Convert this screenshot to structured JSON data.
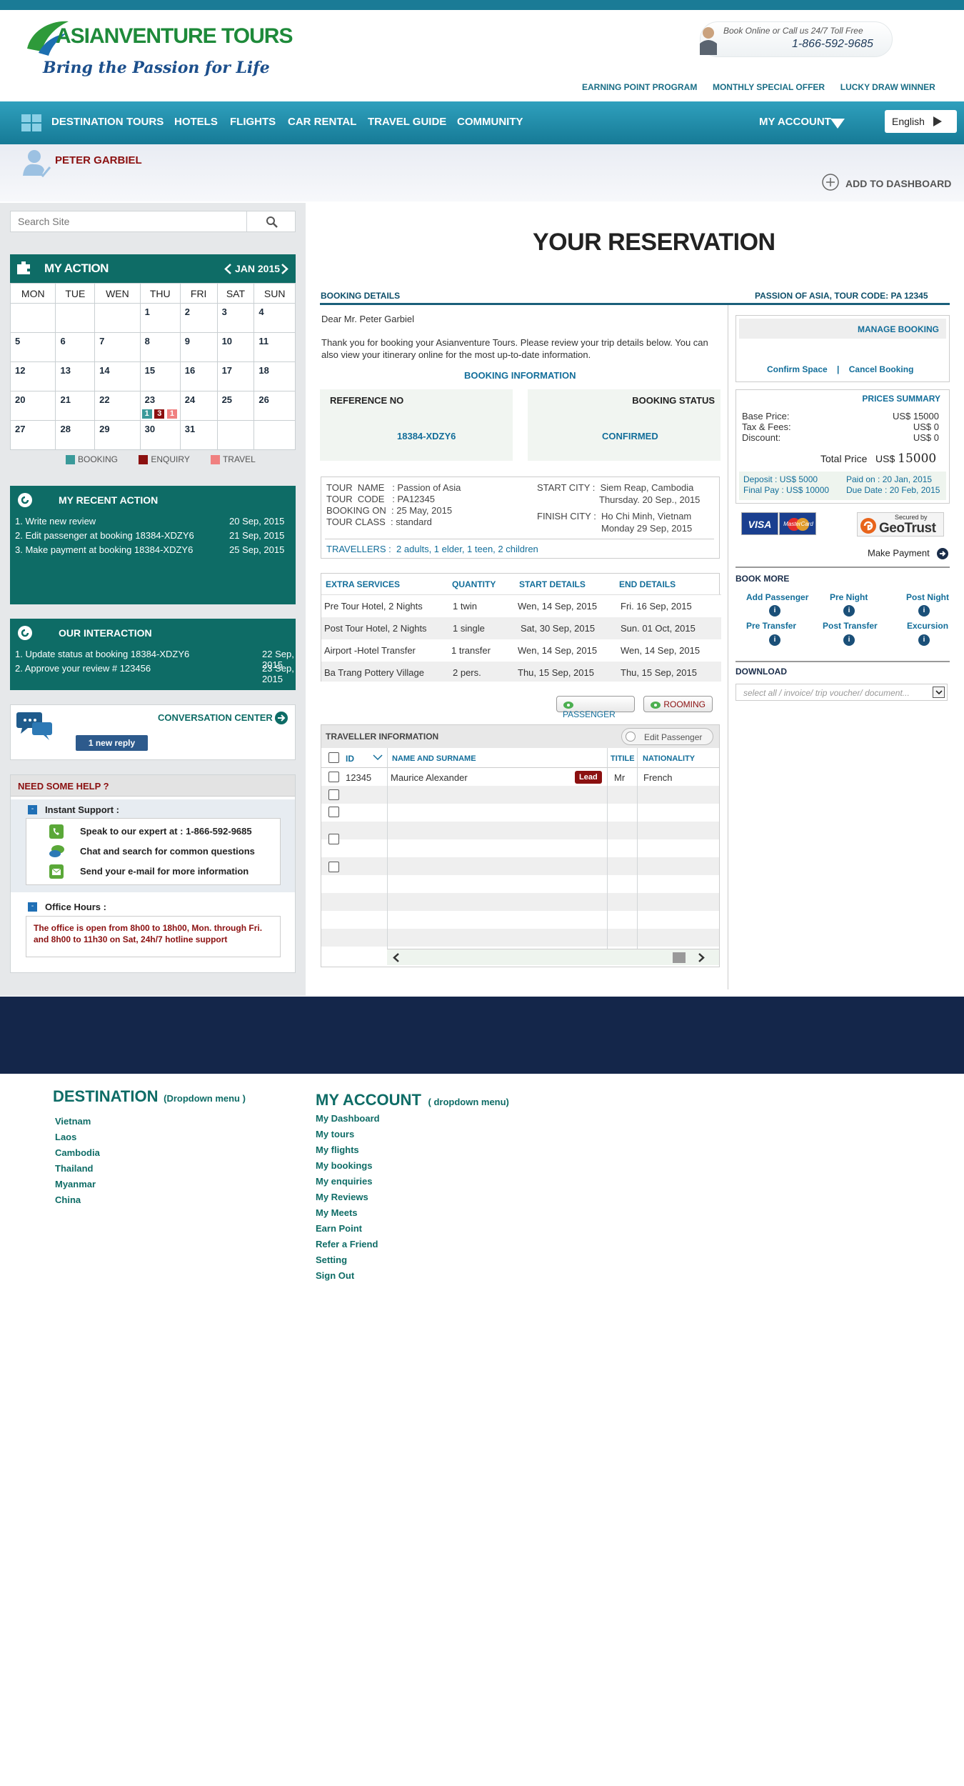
{
  "brand": {
    "name_a": "ASIAN",
    "name_b": "VENTURE TOURS",
    "tagline": "Bring the Passion for Life"
  },
  "contact": {
    "line1": "Book Online or Call us 24/7 Toll Free",
    "phone": "1-866-592-9685"
  },
  "toplinks": [
    "EARNING POINT PROGRAM",
    "MONTHLY SPECIAL OFFER",
    "LUCKY DRAW  WINNER"
  ],
  "nav": {
    "items": [
      "DESTINATION",
      "TOURS",
      "HOTELS",
      "FLIGHTS",
      "CAR RENTAL",
      "TRAVEL GUIDE",
      "COMMUNITY"
    ],
    "account": "MY ACCOUNT",
    "language": "English"
  },
  "user": {
    "name": "PETER GARBIEL",
    "add_dashboard": "ADD TO DASHBOARD"
  },
  "search": {
    "placeholder": "Search Site"
  },
  "calendar": {
    "title": "MY ACTION",
    "month": "JAN 2015",
    "days": [
      "MON",
      "TUE",
      "WEN",
      "THU",
      "FRI",
      "SAT",
      "SUN"
    ],
    "weeks": [
      [
        "",
        "",
        "",
        "1",
        "2",
        "3",
        "4"
      ],
      [
        "5",
        "6",
        "7",
        "8",
        "9",
        "10",
        "11"
      ],
      [
        "12",
        "13",
        "14",
        "15",
        "16",
        "17",
        "18"
      ],
      [
        "20",
        "21",
        "22",
        "23",
        "24",
        "25",
        "26"
      ],
      [
        "27",
        "28",
        "29",
        "30",
        "31",
        "",
        ""
      ]
    ],
    "badges": [
      "1",
      "3",
      "1"
    ],
    "legend": [
      "BOOKING",
      "ENQUIRY",
      "TRAVEL"
    ],
    "colors": {
      "booking": "#3a9a9a",
      "enquiry": "#8b1010",
      "travel": "#f08080"
    }
  },
  "recent": {
    "title": "MY RECENT ACTION",
    "items": [
      {
        "text": "1. Write new review",
        "date": "20 Sep, 2015"
      },
      {
        "text": "2. Edit passenger at booking 18384-XDZY6",
        "date": "21 Sep, 2015"
      },
      {
        "text": "3. Make payment at booking 18384-XDZY6",
        "date": "25 Sep, 2015"
      }
    ]
  },
  "interaction": {
    "title": "OUR INTERACTION",
    "items": [
      {
        "text": "1. Update  status at booking 18384-XDZY6",
        "date": "22 Sep, 2015"
      },
      {
        "text": "2.  Approve your review  # 123456",
        "date": "23 Sep, 2015"
      }
    ]
  },
  "conversation": {
    "title": "CONVERSATION CENTER",
    "reply": "1 new reply"
  },
  "help": {
    "title": "NEED SOME HELP ?",
    "instant": "Instant Support :",
    "lines": [
      "Speak to  our  expert at : 1-866-592-9685",
      "Chat and search for common questions",
      "Send your e-mail for more  information"
    ],
    "office": "Office Hours :",
    "office_text": "The office  is open from 8h00 to 18h00, Mon.  through Fri. and 8h00 to 11h30 on  Sat,  24h/7 hotline  support"
  },
  "main": {
    "title": "YOUR RESERVATION",
    "booking_details": "BOOKING DETAILS",
    "tour_code_header": "PASSION OF ASIA, TOUR CODE: PA 12345",
    "greeting": "Dear Mr. Peter Garbiel",
    "intro": "Thank you for booking your  Asianventure Tours. Please review your trip details below. You can also view your itinerary online for the most up-to-date information.",
    "booking_info": "BOOKING INFORMATION",
    "ref_label": "REFERENCE NO",
    "ref_value": "18384-XDZY6",
    "status_label": "BOOKING STATUS",
    "status_value": "CONFIRMED",
    "tour": {
      "name": "TOUR  NAME   : Passion of Asia",
      "code": "TOUR  CODE   : PA12345",
      "on": "BOOKING ON  : 25 May, 2015",
      "class": "TOUR CLASS  : standard",
      "start": "START CITY :  Siem Reap, Cambodia",
      "start_date": "Thursday. 20 Sep., 2015",
      "finish": "FINISH CITY :  Ho Chi Minh, Vietnam",
      "finish_date": "Monday 29 Sep, 2015",
      "travellers_label": "TRAVELLERS :",
      "travellers": "2 adults, 1 elder, 1 teen, 2 children"
    },
    "services": {
      "headers": [
        "EXTRA SERVICES",
        "QUANTITY",
        "START DETAILS",
        "END DETAILS"
      ],
      "rows": [
        [
          "Pre Tour Hotel, 2 Nights",
          "1 twin",
          "Wen, 14 Sep, 2015",
          "Fri. 16 Sep, 2015"
        ],
        [
          "Post Tour Hotel, 2 Nights",
          "1 single",
          "Sat, 30 Sep, 2015",
          "Sun. 01 Oct, 2015"
        ],
        [
          "Airport -Hotel Transfer",
          "1 transfer",
          "Wen, 14 Sep, 2015",
          "Wen, 14 Sep, 2015"
        ],
        [
          "Ba Trang Pottery Village",
          "2 pers.",
          "Thu, 15 Sep, 2015",
          "Thu, 15 Sep, 2015"
        ]
      ]
    },
    "passenger_btn": "PASSENGER",
    "rooming_btn": "ROOMING",
    "traveller": {
      "title": "TRAVELLER  INFORMATION",
      "edit": "Edit Passenger",
      "headers": [
        "ID",
        "NAME AND SURNAME",
        "TITILE",
        "NATIONALITY"
      ],
      "row": {
        "id": "12345",
        "name": "Maurice  Alexander",
        "lead": "Lead",
        "title": "Mr",
        "nationality": "French"
      }
    }
  },
  "side": {
    "manage": "MANAGE BOOKING",
    "confirm": "Confirm Space",
    "sep": "|",
    "cancel": "Cancel Booking",
    "prices_title": "PRICES  SUMMARY",
    "base_label": "Base  Price:",
    "base_value": "US$ 15000",
    "tax_label": "Tax & Fees:",
    "tax_value": "US$ 0",
    "discount_label": "Discount:",
    "discount_value": "US$ 0",
    "total_label": "Total Price",
    "total_currency": "US$",
    "total_value": "15000",
    "deposit": "Deposit    : US$ 5000",
    "paid_on": "Paid on      : 20 Jan, 2015",
    "final_pay": "Final Pay : US$ 10000",
    "due_date": "Due Date : 20 Feb, 2015",
    "visa": "VISA",
    "mastercard": "MasterCard",
    "secured": "Secured by",
    "geotrust": "GeoTrust",
    "make_payment": "Make Payment",
    "book_more": "BOOK MORE",
    "book_items": [
      "Add Passenger",
      "Pre Night",
      "Post Night",
      "Pre Transfer",
      "Post Transfer",
      "Excursion"
    ],
    "download": "DOWNLOAD",
    "download_placeholder": "select all / invoice/ trip voucher/ document..."
  },
  "footer": {
    "dest_title": "DESTINATION",
    "dest_note": "(Dropdown menu )",
    "dest_items": [
      "Vietnam",
      "Laos",
      "Cambodia",
      "Thailand",
      "Myanmar",
      "China"
    ],
    "acct_title": "MY ACCOUNT",
    "acct_note": "( dropdown menu)",
    "acct_items": [
      "My Dashboard",
      "My tours",
      "My flights",
      "My bookings",
      "My enquiries",
      "My Reviews",
      "My Meets",
      "Earn Point",
      "Refer a Friend",
      "Setting",
      "Sign Out"
    ]
  }
}
